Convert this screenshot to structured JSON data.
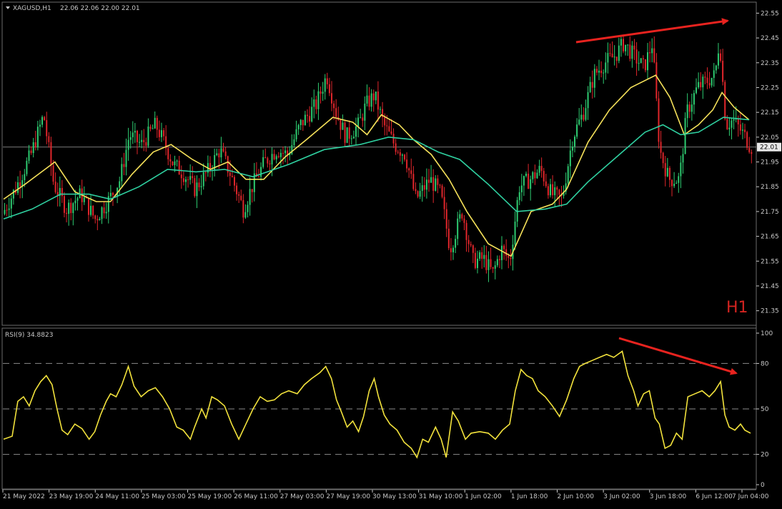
{
  "header": {
    "symbol": "XAGUSD,H1",
    "ohlc": "22.06 22.06 22.00 22.01",
    "timeframe_badge": "H1"
  },
  "rsi_panel": {
    "title": "RSI(9) 34.8823"
  },
  "colors": {
    "background": "#000000",
    "bull_candle": "#2ecc71",
    "bear_candle": "#e0262b",
    "fast_ma": "#f5e15a",
    "slow_ma": "#2fd0a0",
    "rsi_line": "#f2e23c",
    "arrow": "#e8231f",
    "grid_dash": "#8a8a8a",
    "axis": "#c8c8c8"
  },
  "chart_data": [
    {
      "type": "candlestick",
      "symbol": "XAGUSD",
      "timeframe": "H1",
      "ylim": [
        21.3,
        22.58
      ],
      "y_ticks": [
        "22.55",
        "22.45",
        "22.35",
        "22.25",
        "22.15",
        "22.05",
        "21.95",
        "21.85",
        "21.75",
        "21.65",
        "21.55",
        "21.45",
        "21.35"
      ],
      "x_ticks": [
        "21 May 2022",
        "23 May 19:00",
        "24 May 11:00",
        "25 May 03:00",
        "25 May 19:00",
        "26 May 11:00",
        "27 May 03:00",
        "27 May 19:00",
        "30 May 13:00",
        "31 May 10:00",
        "1 Jun 02:00",
        "1 Jun 18:00",
        "2 Jun 10:00",
        "3 Jun 02:00",
        "3 Jun 18:00",
        "6 Jun 12:00",
        "7 Jun 04:00"
      ],
      "current_price": "22.01",
      "close_path": [
        [
          0,
          21.74
        ],
        [
          18,
          21.84
        ],
        [
          40,
          21.98
        ],
        [
          58,
          22.14
        ],
        [
          72,
          21.86
        ],
        [
          90,
          21.76
        ],
        [
          110,
          21.82
        ],
        [
          130,
          21.72
        ],
        [
          150,
          21.8
        ],
        [
          165,
          21.88
        ],
        [
          178,
          22.06
        ],
        [
          195,
          22.02
        ],
        [
          215,
          22.1
        ],
        [
          228,
          22.02
        ],
        [
          240,
          21.94
        ],
        [
          255,
          21.9
        ],
        [
          270,
          21.84
        ],
        [
          290,
          21.92
        ],
        [
          305,
          22.0
        ],
        [
          320,
          21.9
        ],
        [
          338,
          21.76
        ],
        [
          350,
          21.85
        ],
        [
          368,
          21.95
        ],
        [
          385,
          22.0
        ],
        [
          400,
          21.98
        ],
        [
          418,
          22.1
        ],
        [
          440,
          22.18
        ],
        [
          455,
          22.3
        ],
        [
          468,
          22.15
        ],
        [
          482,
          22.05
        ],
        [
          500,
          22.1
        ],
        [
          510,
          22.18
        ],
        [
          522,
          22.22
        ],
        [
          535,
          22.1
        ],
        [
          550,
          22.02
        ],
        [
          565,
          21.98
        ],
        [
          580,
          21.8
        ],
        [
          600,
          21.88
        ],
        [
          615,
          21.82
        ],
        [
          628,
          21.6
        ],
        [
          645,
          21.75
        ],
        [
          660,
          21.55
        ],
        [
          675,
          21.56
        ],
        [
          688,
          21.5
        ],
        [
          700,
          21.6
        ],
        [
          712,
          21.55
        ],
        [
          725,
          21.85
        ],
        [
          740,
          21.88
        ],
        [
          755,
          21.92
        ],
        [
          770,
          21.82
        ],
        [
          785,
          21.8
        ],
        [
          800,
          22.05
        ],
        [
          815,
          22.15
        ],
        [
          830,
          22.3
        ],
        [
          845,
          22.35
        ],
        [
          860,
          22.38
        ],
        [
          872,
          22.43
        ],
        [
          885,
          22.38
        ],
        [
          900,
          22.33
        ],
        [
          912,
          22.43
        ],
        [
          922,
          22.0
        ],
        [
          935,
          21.88
        ],
        [
          950,
          21.88
        ],
        [
          960,
          22.15
        ],
        [
          975,
          22.25
        ],
        [
          990,
          22.28
        ],
        [
          1000,
          22.3
        ],
        [
          1006,
          22.45
        ],
        [
          1015,
          22.1
        ],
        [
          1025,
          22.12
        ],
        [
          1040,
          22.06
        ],
        [
          1050,
          22.01
        ]
      ],
      "series": [
        {
          "name": "",
          "kind": "fast_ma",
          "values": [
            [
              0,
              21.8
            ],
            [
              30,
              21.86
            ],
            [
              72,
              21.95
            ],
            [
              100,
              21.83
            ],
            [
              130,
              21.79
            ],
            [
              150,
              21.79
            ],
            [
              180,
              21.9
            ],
            [
              210,
              21.99
            ],
            [
              235,
              22.02
            ],
            [
              265,
              21.96
            ],
            [
              290,
              21.92
            ],
            [
              315,
              21.95
            ],
            [
              340,
              21.88
            ],
            [
              365,
              21.88
            ],
            [
              395,
              21.97
            ],
            [
              425,
              22.04
            ],
            [
              462,
              22.13
            ],
            [
              490,
              22.11
            ],
            [
              510,
              22.06
            ],
            [
              530,
              22.14
            ],
            [
              555,
              22.1
            ],
            [
              575,
              22.04
            ],
            [
              600,
              21.98
            ],
            [
              625,
              21.88
            ],
            [
              650,
              21.75
            ],
            [
              680,
              21.62
            ],
            [
              712,
              21.57
            ],
            [
              740,
              21.75
            ],
            [
              770,
              21.78
            ],
            [
              790,
              21.84
            ],
            [
              820,
              22.03
            ],
            [
              850,
              22.16
            ],
            [
              880,
              22.25
            ],
            [
              915,
              22.3
            ],
            [
              935,
              22.21
            ],
            [
              955,
              22.06
            ],
            [
              975,
              22.1
            ],
            [
              995,
              22.16
            ],
            [
              1008,
              22.23
            ],
            [
              1025,
              22.17
            ],
            [
              1046,
              22.12
            ]
          ]
        },
        {
          "name": "",
          "kind": "slow_ma",
          "values": [
            [
              0,
              21.72
            ],
            [
              40,
              21.76
            ],
            [
              80,
              21.82
            ],
            [
              120,
              21.82
            ],
            [
              150,
              21.8
            ],
            [
              190,
              21.85
            ],
            [
              230,
              21.92
            ],
            [
              270,
              21.91
            ],
            [
              310,
              21.92
            ],
            [
              350,
              21.89
            ],
            [
              400,
              21.94
            ],
            [
              450,
              22.0
            ],
            [
              500,
              22.02
            ],
            [
              540,
              22.05
            ],
            [
              575,
              22.04
            ],
            [
              610,
              21.99
            ],
            [
              640,
              21.96
            ],
            [
              680,
              21.86
            ],
            [
              720,
              21.75
            ],
            [
              760,
              21.76
            ],
            [
              790,
              21.78
            ],
            [
              820,
              21.87
            ],
            [
              860,
              21.97
            ],
            [
              900,
              22.07
            ],
            [
              925,
              22.1
            ],
            [
              950,
              22.06
            ],
            [
              975,
              22.07
            ],
            [
              1010,
              22.13
            ],
            [
              1046,
              22.12
            ]
          ]
        }
      ],
      "annotations": [
        "upward trend arrow over price highs",
        "H1"
      ]
    },
    {
      "type": "line",
      "title": "RSI(9) 34.8823",
      "ylim": [
        0,
        100
      ],
      "y_ticks": [
        100,
        80,
        50,
        20,
        0
      ],
      "reference_lines": [
        80,
        50,
        20
      ],
      "series": [
        {
          "name": "RSI(9)",
          "values": [
            [
              0,
              30
            ],
            [
              12,
              32
            ],
            [
              20,
              55
            ],
            [
              28,
              58
            ],
            [
              36,
              52
            ],
            [
              44,
              62
            ],
            [
              52,
              68
            ],
            [
              60,
              72
            ],
            [
              68,
              66
            ],
            [
              75,
              50
            ],
            [
              82,
              36
            ],
            [
              90,
              33
            ],
            [
              100,
              40
            ],
            [
              110,
              37
            ],
            [
              120,
              30
            ],
            [
              128,
              35
            ],
            [
              136,
              46
            ],
            [
              144,
              55
            ],
            [
              150,
              60
            ],
            [
              158,
              58
            ],
            [
              166,
              66
            ],
            [
              175,
              78
            ],
            [
              183,
              65
            ],
            [
              193,
              58
            ],
            [
              203,
              62
            ],
            [
              213,
              64
            ],
            [
              223,
              58
            ],
            [
              233,
              50
            ],
            [
              243,
              38
            ],
            [
              252,
              36
            ],
            [
              262,
              30
            ],
            [
              268,
              38
            ],
            [
              278,
              50
            ],
            [
              284,
              44
            ],
            [
              292,
              58
            ],
            [
              300,
              56
            ],
            [
              310,
              52
            ],
            [
              320,
              40
            ],
            [
              330,
              30
            ],
            [
              340,
              40
            ],
            [
              350,
              50
            ],
            [
              360,
              58
            ],
            [
              370,
              55
            ],
            [
              380,
              56
            ],
            [
              390,
              60
            ],
            [
              400,
              62
            ],
            [
              412,
              60
            ],
            [
              422,
              66
            ],
            [
              432,
              70
            ],
            [
              444,
              74
            ],
            [
              452,
              78
            ],
            [
              460,
              70
            ],
            [
              467,
              56
            ],
            [
              474,
              48
            ],
            [
              482,
              38
            ],
            [
              490,
              42
            ],
            [
              498,
              35
            ],
            [
              505,
              45
            ],
            [
              513,
              62
            ],
            [
              520,
              70
            ],
            [
              526,
              58
            ],
            [
              534,
              46
            ],
            [
              542,
              40
            ],
            [
              552,
              36
            ],
            [
              562,
              28
            ],
            [
              572,
              24
            ],
            [
              580,
              18
            ],
            [
              588,
              30
            ],
            [
              596,
              28
            ],
            [
              606,
              38
            ],
            [
              614,
              30
            ],
            [
              621,
              18
            ],
            [
              630,
              48
            ],
            [
              638,
              42
            ],
            [
              648,
              30
            ],
            [
              656,
              34
            ],
            [
              668,
              35
            ],
            [
              680,
              34
            ],
            [
              690,
              30
            ],
            [
              700,
              36
            ],
            [
              710,
              40
            ],
            [
              718,
              62
            ],
            [
              726,
              76
            ],
            [
              734,
              72
            ],
            [
              742,
              70
            ],
            [
              750,
              62
            ],
            [
              760,
              58
            ],
            [
              770,
              52
            ],
            [
              780,
              45
            ],
            [
              790,
              56
            ],
            [
              800,
              70
            ],
            [
              808,
              78
            ],
            [
              816,
              80
            ],
            [
              826,
              82
            ],
            [
              836,
              84
            ],
            [
              846,
              86
            ],
            [
              856,
              84
            ],
            [
              868,
              88
            ],
            [
              876,
              72
            ],
            [
              884,
              62
            ],
            [
              890,
              52
            ],
            [
              898,
              60
            ],
            [
              906,
              62
            ],
            [
              914,
              44
            ],
            [
              920,
              40
            ],
            [
              928,
              24
            ],
            [
              936,
              26
            ],
            [
              944,
              34
            ],
            [
              952,
              30
            ],
            [
              960,
              58
            ],
            [
              970,
              60
            ],
            [
              980,
              62
            ],
            [
              990,
              58
            ],
            [
              998,
              62
            ],
            [
              1006,
              68
            ],
            [
              1012,
              46
            ],
            [
              1018,
              38
            ],
            [
              1026,
              36
            ],
            [
              1034,
              40
            ],
            [
              1040,
              36
            ],
            [
              1048,
              34
            ]
          ]
        }
      ],
      "annotations": [
        "downward divergence arrow over RSI peaks"
      ]
    }
  ]
}
